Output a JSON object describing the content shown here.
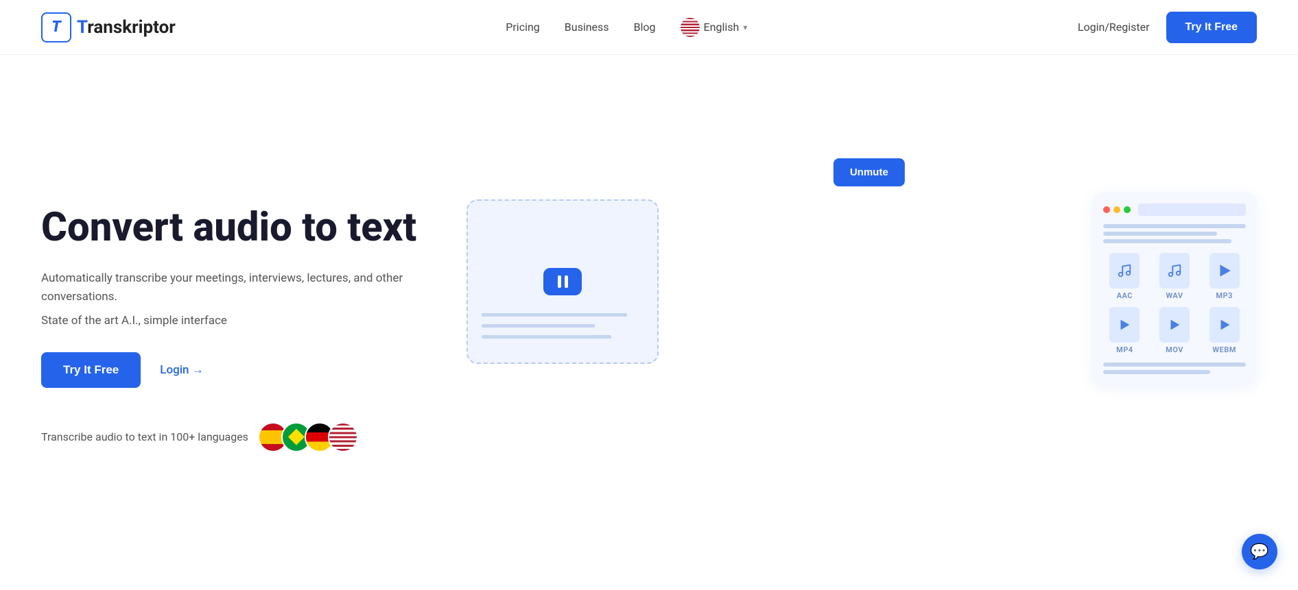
{
  "brand": {
    "name": "Transkriptor",
    "logo_letter": "T"
  },
  "nav": {
    "links": [
      {
        "id": "pricing",
        "label": "Pricing"
      },
      {
        "id": "business",
        "label": "Business"
      },
      {
        "id": "blog",
        "label": "Blog"
      }
    ],
    "language": {
      "label": "English",
      "flag": "us"
    },
    "login_label": "Login/Register",
    "cta_label": "Try It Free"
  },
  "hero": {
    "title": "Convert audio to text",
    "subtitle": "Automatically transcribe your meetings, interviews, lectures, and other conversations.",
    "state_of_art": "State of the art A.I., simple interface",
    "cta_primary": "Try It Free",
    "cta_secondary": "Login →",
    "languages_text": "Transcribe audio to text in 100+ languages"
  },
  "illustration": {
    "unmute_label": "Unmute",
    "file_formats": [
      {
        "label": "AAC",
        "type": "audio"
      },
      {
        "label": "WAV",
        "type": "audio"
      },
      {
        "label": "MP3",
        "type": "audio"
      },
      {
        "label": "MP4",
        "type": "video"
      },
      {
        "label": "MOV",
        "type": "video"
      },
      {
        "label": "WEBM",
        "type": "video"
      }
    ]
  },
  "chat": {
    "icon_label": "💬"
  }
}
